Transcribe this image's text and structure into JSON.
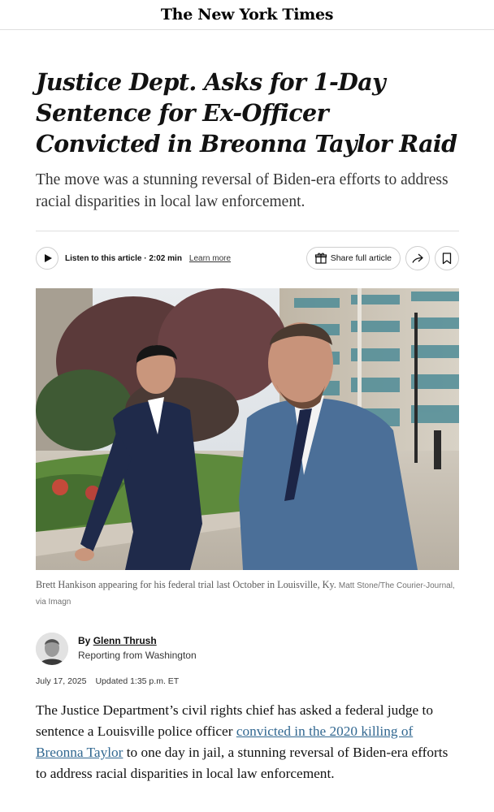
{
  "masthead": {
    "title": "The New York Times"
  },
  "article": {
    "headline": "Justice Dept. Asks for 1-Day Sentence for Ex-Officer Convicted in Breonna Taylor Raid",
    "summary": "The move was a stunning reversal of Biden-era efforts to address racial disparities in local law enforcement."
  },
  "toolbar": {
    "listen_label": "Listen to this article · 2:02 min",
    "learn_more": "Learn more",
    "share_label": "Share full article",
    "icons": {
      "play": "play-icon",
      "gift": "gift-icon",
      "share": "share-arrow-icon",
      "bookmark": "bookmark-icon"
    }
  },
  "caption": {
    "text": "Brett Hankison appearing for his federal trial last October in Louisville, Ky.",
    "credit": "Matt Stone/The Courier-Journal, via Imagn"
  },
  "byline": {
    "by": "By ",
    "author": "Glenn Thrush",
    "location": "Reporting from Washington"
  },
  "dates": {
    "published": "July 17, 2025",
    "updated": "Updated 1:35 p.m. ET"
  },
  "body": {
    "p1_a": "The Justice Department’s civil rights chief has asked a federal judge to sentence a Louisville police officer ",
    "p1_link": "convicted in the 2020 killing of Breonna Taylor",
    "p1_b": " to one day in jail, a stunning reversal of Biden-era efforts to address racial disparities in local law enforcement."
  },
  "colors": {
    "link": "#326891",
    "text": "#121212",
    "rule": "#dfdfdf"
  }
}
